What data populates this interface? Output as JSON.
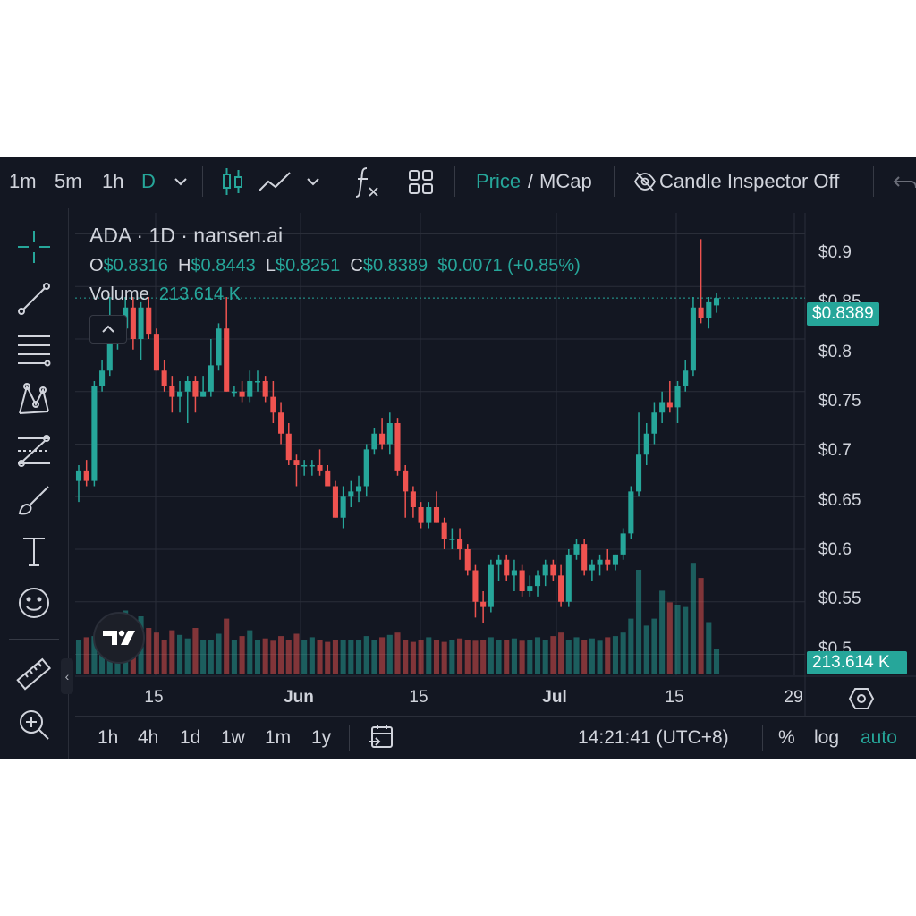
{
  "toolbar": {
    "intervals": [
      "1m",
      "5m",
      "1h",
      "D"
    ],
    "active_interval": "D",
    "price_label": "Price",
    "slash": "/",
    "mcap_label": "MCap",
    "candle_inspector": "Candle Inspector Off"
  },
  "legend": {
    "title": "ADA · 1D · nansen.ai",
    "open_label": "O",
    "open_value": "$0.8316",
    "high_label": "H",
    "high_value": "$0.8443",
    "low_label": "L",
    "low_value": "$0.8251",
    "close_label": "C",
    "close_value": "$0.8389",
    "change": "$0.0071 (+0.85%)",
    "volume_label": "Volume",
    "volume_value": "213.614 K"
  },
  "price_axis": {
    "ticks": [
      "$0.9",
      "$0.85",
      "$0.8",
      "$0.75",
      "$0.7",
      "$0.65",
      "$0.6",
      "$0.55",
      "$0.5"
    ],
    "last_price_tag": "$0.8389",
    "volume_tag": "213.614 K"
  },
  "time_axis": {
    "ticks": [
      {
        "label": "15",
        "bold": false
      },
      {
        "label": "Jun",
        "bold": true
      },
      {
        "label": "15",
        "bold": false
      },
      {
        "label": "Jul",
        "bold": true
      },
      {
        "label": "15",
        "bold": false
      },
      {
        "label": "29",
        "bold": false
      }
    ]
  },
  "bottom_bar": {
    "ranges": [
      "1h",
      "4h",
      "1d",
      "1w",
      "1m",
      "1y"
    ],
    "time": "14:21:41 (UTC+8)",
    "percent": "%",
    "log": "log",
    "auto": "auto"
  },
  "colors": {
    "up": "#26a69a",
    "down": "#ef5350",
    "background": "#131722",
    "grid": "#2a2e39"
  },
  "chart_data": {
    "type": "candlestick",
    "title": "ADA · 1D · nansen.ai",
    "ylim": [
      0.48,
      0.92
    ],
    "candles": [
      [
        0.665,
        0.68,
        0.645,
        0.675
      ],
      [
        0.675,
        0.685,
        0.66,
        0.665
      ],
      [
        0.665,
        0.76,
        0.66,
        0.755
      ],
      [
        0.755,
        0.78,
        0.75,
        0.77
      ],
      [
        0.77,
        0.84,
        0.765,
        0.8
      ],
      [
        0.8,
        0.815,
        0.79,
        0.81
      ],
      [
        0.81,
        0.84,
        0.8,
        0.83
      ],
      [
        0.83,
        0.84,
        0.79,
        0.8
      ],
      [
        0.8,
        0.835,
        0.78,
        0.83
      ],
      [
        0.83,
        0.84,
        0.8,
        0.805
      ],
      [
        0.805,
        0.81,
        0.77,
        0.77
      ],
      [
        0.77,
        0.78,
        0.75,
        0.755
      ],
      [
        0.755,
        0.765,
        0.73,
        0.745
      ],
      [
        0.745,
        0.76,
        0.73,
        0.75
      ],
      [
        0.75,
        0.765,
        0.72,
        0.76
      ],
      [
        0.76,
        0.765,
        0.73,
        0.745
      ],
      [
        0.745,
        0.765,
        0.745,
        0.75
      ],
      [
        0.75,
        0.8,
        0.745,
        0.775
      ],
      [
        0.775,
        0.815,
        0.77,
        0.81
      ],
      [
        0.81,
        0.84,
        0.75,
        0.75
      ],
      [
        0.75,
        0.755,
        0.745,
        0.75
      ],
      [
        0.75,
        0.76,
        0.74,
        0.745
      ],
      [
        0.745,
        0.77,
        0.74,
        0.76
      ],
      [
        0.76,
        0.77,
        0.75,
        0.76
      ],
      [
        0.76,
        0.765,
        0.74,
        0.745
      ],
      [
        0.745,
        0.76,
        0.72,
        0.73
      ],
      [
        0.73,
        0.74,
        0.7,
        0.71
      ],
      [
        0.71,
        0.72,
        0.68,
        0.685
      ],
      [
        0.685,
        0.69,
        0.66,
        0.68
      ],
      [
        0.68,
        0.685,
        0.67,
        0.68
      ],
      [
        0.68,
        0.685,
        0.67,
        0.68
      ],
      [
        0.68,
        0.695,
        0.67,
        0.675
      ],
      [
        0.675,
        0.68,
        0.66,
        0.66
      ],
      [
        0.66,
        0.665,
        0.63,
        0.63
      ],
      [
        0.63,
        0.66,
        0.62,
        0.65
      ],
      [
        0.65,
        0.665,
        0.64,
        0.655
      ],
      [
        0.655,
        0.67,
        0.645,
        0.66
      ],
      [
        0.66,
        0.7,
        0.65,
        0.695
      ],
      [
        0.695,
        0.715,
        0.69,
        0.71
      ],
      [
        0.71,
        0.725,
        0.695,
        0.7
      ],
      [
        0.7,
        0.73,
        0.69,
        0.72
      ],
      [
        0.72,
        0.725,
        0.67,
        0.675
      ],
      [
        0.675,
        0.68,
        0.63,
        0.655
      ],
      [
        0.655,
        0.66,
        0.63,
        0.64
      ],
      [
        0.64,
        0.645,
        0.62,
        0.625
      ],
      [
        0.625,
        0.645,
        0.62,
        0.64
      ],
      [
        0.64,
        0.655,
        0.625,
        0.625
      ],
      [
        0.625,
        0.63,
        0.6,
        0.61
      ],
      [
        0.61,
        0.62,
        0.6,
        0.61
      ],
      [
        0.61,
        0.62,
        0.59,
        0.6
      ],
      [
        0.6,
        0.605,
        0.575,
        0.58
      ],
      [
        0.58,
        0.585,
        0.535,
        0.55
      ],
      [
        0.55,
        0.56,
        0.53,
        0.545
      ],
      [
        0.545,
        0.59,
        0.54,
        0.585
      ],
      [
        0.585,
        0.595,
        0.57,
        0.59
      ],
      [
        0.59,
        0.595,
        0.57,
        0.575
      ],
      [
        0.575,
        0.59,
        0.56,
        0.58
      ],
      [
        0.58,
        0.585,
        0.555,
        0.56
      ],
      [
        0.56,
        0.575,
        0.555,
        0.565
      ],
      [
        0.565,
        0.58,
        0.555,
        0.575
      ],
      [
        0.575,
        0.59,
        0.565,
        0.585
      ],
      [
        0.585,
        0.59,
        0.57,
        0.575
      ],
      [
        0.575,
        0.585,
        0.545,
        0.55
      ],
      [
        0.55,
        0.6,
        0.545,
        0.595
      ],
      [
        0.595,
        0.61,
        0.59,
        0.605
      ],
      [
        0.605,
        0.61,
        0.575,
        0.58
      ],
      [
        0.58,
        0.59,
        0.57,
        0.585
      ],
      [
        0.585,
        0.595,
        0.575,
        0.59
      ],
      [
        0.59,
        0.6,
        0.58,
        0.585
      ],
      [
        0.585,
        0.595,
        0.58,
        0.595
      ],
      [
        0.595,
        0.62,
        0.59,
        0.615
      ],
      [
        0.615,
        0.66,
        0.61,
        0.655
      ],
      [
        0.655,
        0.73,
        0.65,
        0.69
      ],
      [
        0.69,
        0.72,
        0.68,
        0.71
      ],
      [
        0.71,
        0.74,
        0.7,
        0.73
      ],
      [
        0.73,
        0.75,
        0.72,
        0.74
      ],
      [
        0.74,
        0.76,
        0.73,
        0.735
      ],
      [
        0.735,
        0.76,
        0.72,
        0.755
      ],
      [
        0.755,
        0.78,
        0.75,
        0.77
      ],
      [
        0.77,
        0.84,
        0.765,
        0.83
      ],
      [
        0.83,
        0.895,
        0.815,
        0.82
      ],
      [
        0.82,
        0.84,
        0.81,
        0.835
      ],
      [
        0.832,
        0.844,
        0.825,
        0.839
      ]
    ],
    "volume": [
      0.3,
      0.32,
      0.33,
      0.35,
      0.4,
      0.42,
      0.55,
      0.3,
      0.5,
      0.4,
      0.36,
      0.3,
      0.38,
      0.34,
      0.31,
      0.4,
      0.3,
      0.3,
      0.35,
      0.48,
      0.3,
      0.33,
      0.38,
      0.3,
      0.31,
      0.29,
      0.33,
      0.3,
      0.35,
      0.3,
      0.32,
      0.3,
      0.28,
      0.3,
      0.3,
      0.3,
      0.3,
      0.33,
      0.3,
      0.32,
      0.34,
      0.36,
      0.3,
      0.28,
      0.3,
      0.32,
      0.3,
      0.28,
      0.3,
      0.31,
      0.3,
      0.29,
      0.3,
      0.32,
      0.3,
      0.3,
      0.31,
      0.29,
      0.3,
      0.32,
      0.3,
      0.33,
      0.36,
      0.3,
      0.32,
      0.3,
      0.31,
      0.29,
      0.32,
      0.33,
      0.36,
      0.48,
      0.9,
      0.42,
      0.48,
      0.72,
      0.62,
      0.6,
      0.58,
      0.96,
      0.83,
      0.45,
      0.22
    ]
  }
}
